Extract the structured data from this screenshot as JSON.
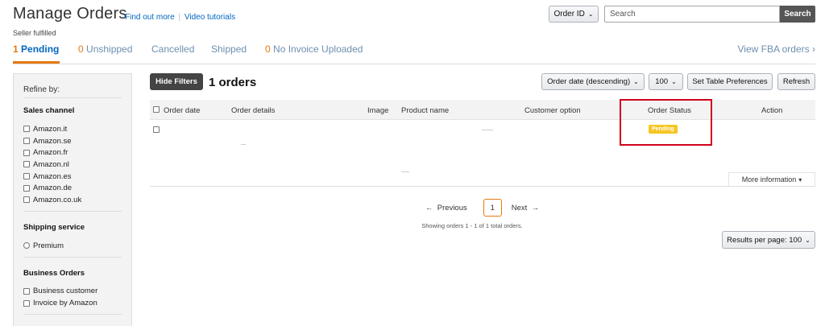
{
  "header": {
    "title": "Manage Orders",
    "find_out_more": "Find out more",
    "separator": "|",
    "video_tutorials": "Video tutorials",
    "subtitle": "Seller fulfilled"
  },
  "search": {
    "field_select": "Order ID",
    "placeholder": "Search",
    "button": "Search"
  },
  "tabs": [
    {
      "count": "1",
      "label": "Pending"
    },
    {
      "count": "0",
      "label": "Unshipped"
    },
    {
      "count": "",
      "label": "Cancelled"
    },
    {
      "count": "",
      "label": "Shipped"
    },
    {
      "count": "0",
      "label": "No Invoice Uploaded"
    }
  ],
  "view_fba": "View FBA orders",
  "sidebar": {
    "refine_by": "Refine by:",
    "sales_channel": {
      "heading": "Sales channel",
      "options": [
        "Amazon.it",
        "Amazon.se",
        "Amazon.fr",
        "Amazon.nl",
        "Amazon.es",
        "Amazon.de",
        "Amazon.co.uk"
      ]
    },
    "shipping_service": {
      "heading": "Shipping service",
      "options": [
        "Premium"
      ]
    },
    "business_orders": {
      "heading": "Business Orders",
      "options": [
        "Business customer",
        "Invoice by Amazon"
      ]
    }
  },
  "toolbar": {
    "hide_filters": "Hide Filters",
    "orders_count": "1 orders",
    "sort": "Order date (descending)",
    "page_size": "100",
    "table_prefs": "Set Table Preferences",
    "refresh": "Refresh"
  },
  "table": {
    "columns": [
      "Order date",
      "Order details",
      "Image",
      "Product name",
      "Customer option",
      "Order Status",
      "Action"
    ],
    "status_badge": "Pending",
    "more_info": "More information"
  },
  "pagination": {
    "previous": "Previous",
    "current": "1",
    "next": "Next",
    "showing": "Showing orders 1 - 1 of 1 total orders.",
    "results_per_page": "Results per page: 100"
  },
  "colors": {
    "accent_orange": "#e47911",
    "link_blue": "#0066c0",
    "badge_yellow": "#f7c521",
    "highlight_red": "#d0021b"
  }
}
